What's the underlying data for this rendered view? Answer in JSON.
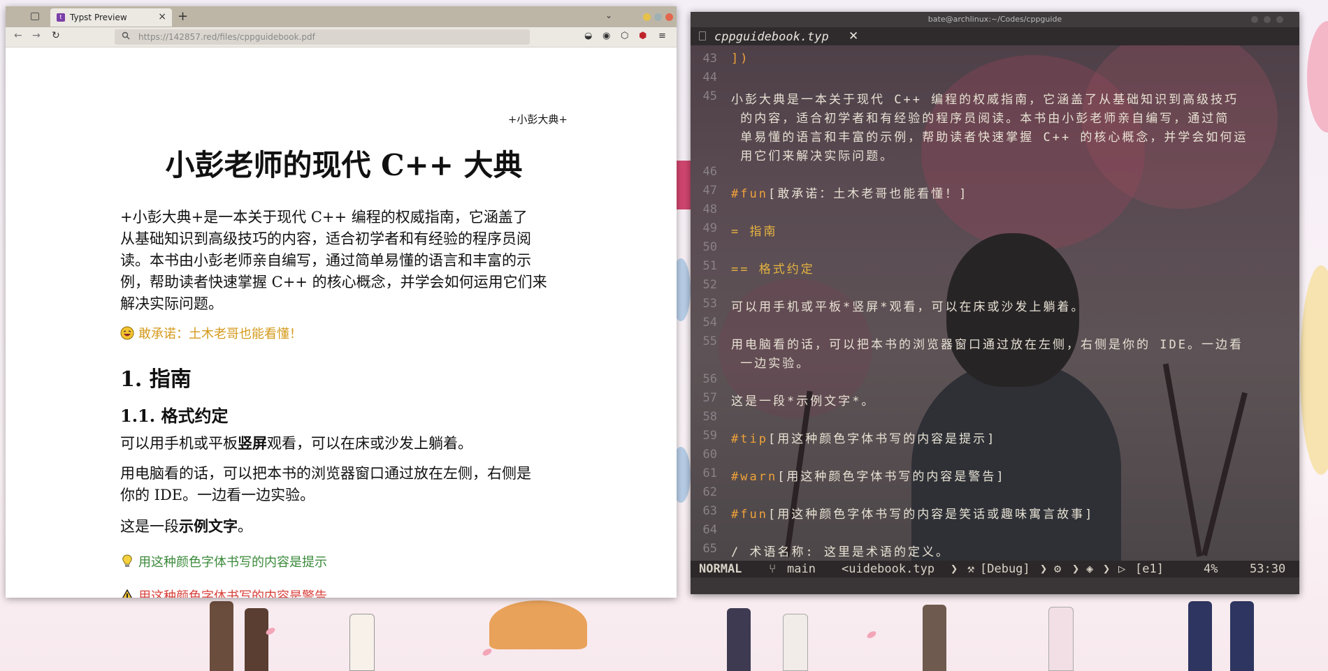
{
  "browser": {
    "tab_title": "Typst Preview",
    "tab_close": "×",
    "new_tab": "+",
    "tab_list": "⌄",
    "back": "←",
    "forward": "→",
    "reload": "↻",
    "url": "https://142857.red/files/cppguidebook.pdf",
    "window_dot_colors": [
      "#e6c24a",
      "#9fb1b3",
      "#e2664e"
    ]
  },
  "pdf": {
    "header": "+小彭大典+",
    "title": "小彭老师的现代 C++ 大典",
    "intro_lines": [
      "+小彭大典+是一本关于现代 C++ 编程的权威指南，它涵盖了",
      "从基础知识到高级技巧的内容，适合初学者和有经验的程序员阅",
      "读。本书由小彭老师亲自编写，通过简单易懂的语言和丰富的示",
      "例，帮助读者快速掌握 C++ 的核心概念，并学会如何运用它们来",
      "解决实际问题。"
    ],
    "fun_note": "敢承诺：土木老哥也能看懂！",
    "h1": "1. 指南",
    "h2": "1.1. 格式约定",
    "p1_before": "可以用手机或平板",
    "p1_bold": "竖屏",
    "p1_after": "观看，可以在床或沙发上躺着。",
    "p2_lines": [
      "用电脑看的话，可以把本书的浏览器窗口通过放在左侧，右侧是",
      "你的 IDE。一边看一边实验。"
    ],
    "p3_before": "这是一段",
    "p3_bold": "示例文字",
    "p3_after": "。",
    "tip_note": "用这种颜色字体书写的内容是提示",
    "warn_note": "用这种颜色字体书写的内容是警告",
    "colors": {
      "fun": "#d49a1c",
      "tip": "#3a8a3a",
      "warn": "#d8403a"
    }
  },
  "terminal": {
    "title": "bate@archlinux:~/Codes/cppguide",
    "buffer_name": "cppguidebook.typ",
    "buffer_close": "✕",
    "lines": [
      {
        "n": "43",
        "t": "])"
      },
      {
        "n": "44",
        "t": ""
      },
      {
        "n": "45",
        "t": "小彭大典是一本关于现代 C++ 编程的权威指南，它涵盖了从基础知识到高级技巧"
      },
      {
        "n": "",
        "t": " 的内容，适合初学者和有经验的程序员阅读。本书由小彭老师亲自编写，通过简"
      },
      {
        "n": "",
        "t": " 单易懂的语言和丰富的示例，帮助读者快速掌握 C++ 的核心概念，并学会如何运"
      },
      {
        "n": "",
        "t": " 用它们来解决实际问题。"
      },
      {
        "n": "46",
        "t": ""
      },
      {
        "n": "47",
        "k": "#fun",
        "t": "[敢承诺：土木老哥也能看懂！]"
      },
      {
        "n": "48",
        "t": ""
      },
      {
        "n": "49",
        "h": "= 指南"
      },
      {
        "n": "50",
        "t": ""
      },
      {
        "n": "51",
        "h": "== 格式约定"
      },
      {
        "n": "52",
        "t": ""
      },
      {
        "n": "53",
        "t": "可以用手机或平板*竖屏*观看，可以在床或沙发上躺着。"
      },
      {
        "n": "54",
        "t": ""
      },
      {
        "n": "55",
        "t": "用电脑看的话，可以把本书的浏览器窗口通过放在左侧，右侧是你的 IDE。一边看"
      },
      {
        "n": "",
        "t": " 一边实验。"
      },
      {
        "n": "56",
        "t": ""
      },
      {
        "n": "57",
        "t": "这是一段*示例文字*。"
      },
      {
        "n": "58",
        "t": ""
      },
      {
        "n": "59",
        "k": "#tip",
        "t": "[用这种颜色字体书写的内容是提示]"
      },
      {
        "n": "60",
        "t": ""
      },
      {
        "n": "61",
        "k": "#warn",
        "t": "[用这种颜色字体书写的内容是警告]"
      },
      {
        "n": "62",
        "t": ""
      },
      {
        "n": "63",
        "k": "#fun",
        "t": "[用这种颜色字体书写的内容是笑话或趣味寓言故事]"
      },
      {
        "n": "64",
        "t": ""
      },
      {
        "n": "65",
        "t": "/ 术语名称: 这里是术语的定义。"
      }
    ],
    "status": {
      "mode": "NORMAL",
      "branch": "main",
      "file": "<uidebook.typ",
      "lsp": "[Debug]",
      "diag": "[e1]",
      "percent": "4%",
      "position": "53:30"
    }
  }
}
